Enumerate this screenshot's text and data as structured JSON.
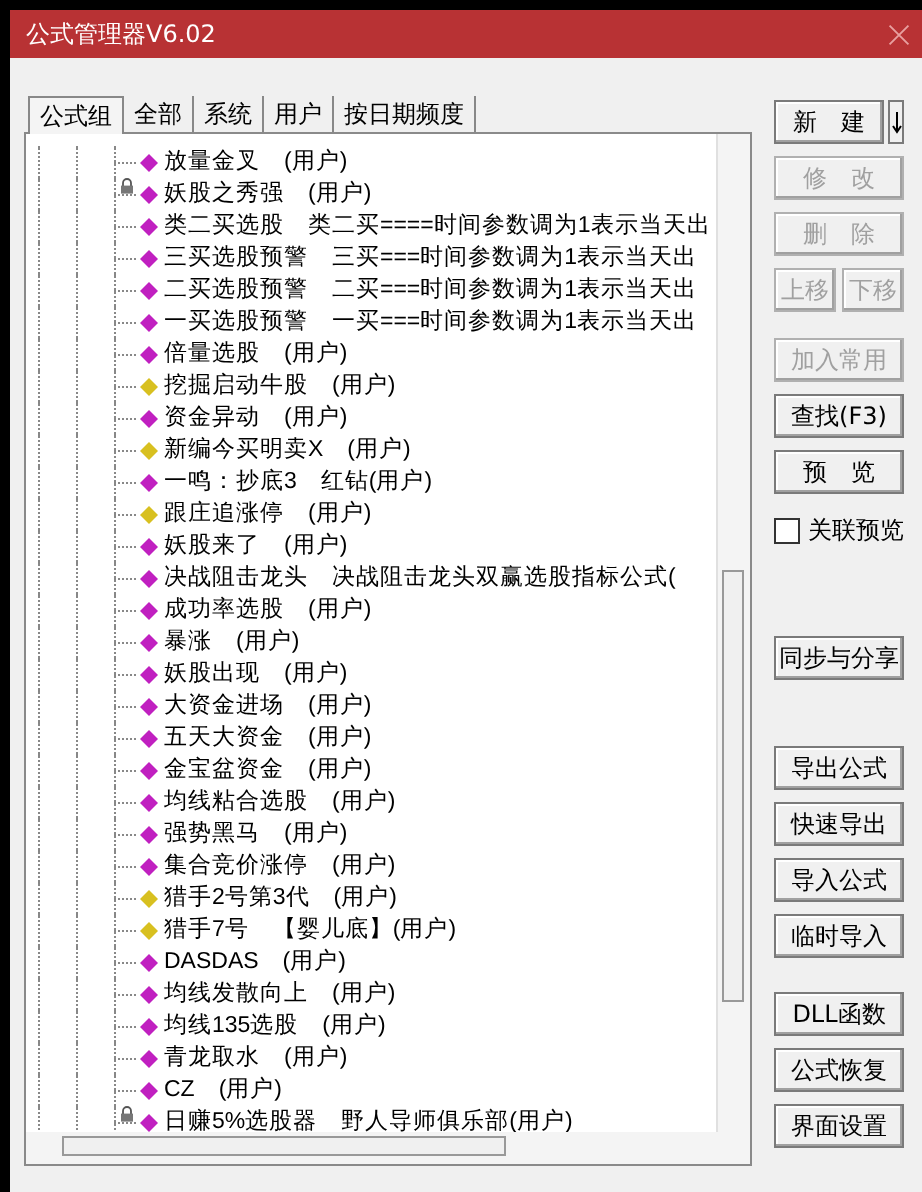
{
  "window": {
    "title": "公式管理器V6.02"
  },
  "tabs": [
    {
      "label": "公式组",
      "selected": true
    },
    {
      "label": "全部",
      "selected": false
    },
    {
      "label": "系统",
      "selected": false
    },
    {
      "label": "用户",
      "selected": false
    },
    {
      "label": "按日期频度",
      "selected": false
    }
  ],
  "formulas": [
    {
      "label": "放量金叉　(用户)",
      "color": "#c020c0",
      "locked": false
    },
    {
      "label": "妖股之秀强　(用户)",
      "color": "#c020c0",
      "locked": true
    },
    {
      "label": "类二买选股　类二买====时间参数调为1表示当天出",
      "color": "#c020c0",
      "locked": false
    },
    {
      "label": "三买选股预警　三买===时间参数调为1表示当天出",
      "color": "#c020c0",
      "locked": false
    },
    {
      "label": "二买选股预警　二买===时间参数调为1表示当天出",
      "color": "#c020c0",
      "locked": false
    },
    {
      "label": "一买选股预警　一买===时间参数调为1表示当天出",
      "color": "#c020c0",
      "locked": false
    },
    {
      "label": "倍量选股　(用户)",
      "color": "#c020c0",
      "locked": false
    },
    {
      "label": "挖掘启动牛股　(用户)",
      "color": "#d8c020",
      "locked": false
    },
    {
      "label": "资金异动　(用户)",
      "color": "#c020c0",
      "locked": false
    },
    {
      "label": "新编今买明卖X　(用户)",
      "color": "#d8c020",
      "locked": false
    },
    {
      "label": "一鸣：抄底3　红钻(用户)",
      "color": "#c020c0",
      "locked": false
    },
    {
      "label": "跟庄追涨停　(用户)",
      "color": "#d8c020",
      "locked": false
    },
    {
      "label": "妖股来了　(用户)",
      "color": "#c020c0",
      "locked": false
    },
    {
      "label": "决战阻击龙头　决战阻击龙头双赢选股指标公式(",
      "color": "#c020c0",
      "locked": false
    },
    {
      "label": "成功率选股　(用户)",
      "color": "#c020c0",
      "locked": false
    },
    {
      "label": "暴涨　(用户)",
      "color": "#c020c0",
      "locked": false
    },
    {
      "label": "妖股出现　(用户)",
      "color": "#c020c0",
      "locked": false
    },
    {
      "label": "大资金进场　(用户)",
      "color": "#c020c0",
      "locked": false
    },
    {
      "label": "五天大资金　(用户)",
      "color": "#c020c0",
      "locked": false
    },
    {
      "label": "金宝盆资金　(用户)",
      "color": "#c020c0",
      "locked": false
    },
    {
      "label": "均线粘合选股　(用户)",
      "color": "#c020c0",
      "locked": false
    },
    {
      "label": "强势黑马　(用户)",
      "color": "#c020c0",
      "locked": false
    },
    {
      "label": "集合竞价涨停　(用户)",
      "color": "#c020c0",
      "locked": false
    },
    {
      "label": "猎手2号第3代　(用户)",
      "color": "#d8c020",
      "locked": false
    },
    {
      "label": "猎手7号　【婴儿底】(用户)",
      "color": "#d8c020",
      "locked": false
    },
    {
      "label": "DASDAS　(用户)",
      "color": "#c020c0",
      "locked": false
    },
    {
      "label": "均线发散向上　(用户)",
      "color": "#c020c0",
      "locked": false
    },
    {
      "label": "均线135选股　(用户)",
      "color": "#c020c0",
      "locked": false
    },
    {
      "label": "青龙取水　(用户)",
      "color": "#c020c0",
      "locked": false
    },
    {
      "label": "CZ　(用户)",
      "color": "#c020c0",
      "locked": false
    },
    {
      "label": "日赚5%选股器　野人导师俱乐部(用户)",
      "color": "#c020c0",
      "locked": true
    }
  ],
  "side_panel": [
    [
      {
        "kind": "split",
        "label": "新　建",
        "disabled": false
      },
      {
        "kind": "button",
        "label": "修　改",
        "disabled": true
      },
      {
        "kind": "button",
        "label": "删　除",
        "disabled": true
      },
      {
        "kind": "pair",
        "buttons": [
          {
            "label": "上移",
            "disabled": true
          },
          {
            "label": "下移",
            "disabled": true
          }
        ]
      }
    ],
    [
      {
        "kind": "button",
        "label": "加入常用",
        "disabled": true
      },
      {
        "kind": "button",
        "label": "查找(F3)",
        "disabled": false
      },
      {
        "kind": "button",
        "label": "预　览",
        "disabled": false
      },
      {
        "kind": "checkbox",
        "label": "关联预览",
        "checked": false
      }
    ],
    [
      {
        "kind": "button",
        "label": "同步与分享",
        "disabled": false
      }
    ],
    [
      {
        "kind": "button",
        "label": "导出公式",
        "disabled": false
      },
      {
        "kind": "button",
        "label": "快速导出",
        "disabled": false
      },
      {
        "kind": "button",
        "label": "导入公式",
        "disabled": false
      },
      {
        "kind": "button",
        "label": "临时导入",
        "disabled": false
      }
    ],
    [
      {
        "kind": "button",
        "label": "DLL函数",
        "disabled": false
      },
      {
        "kind": "button",
        "label": "公式恢复",
        "disabled": false
      },
      {
        "kind": "button",
        "label": "界面设置",
        "disabled": false
      }
    ]
  ]
}
